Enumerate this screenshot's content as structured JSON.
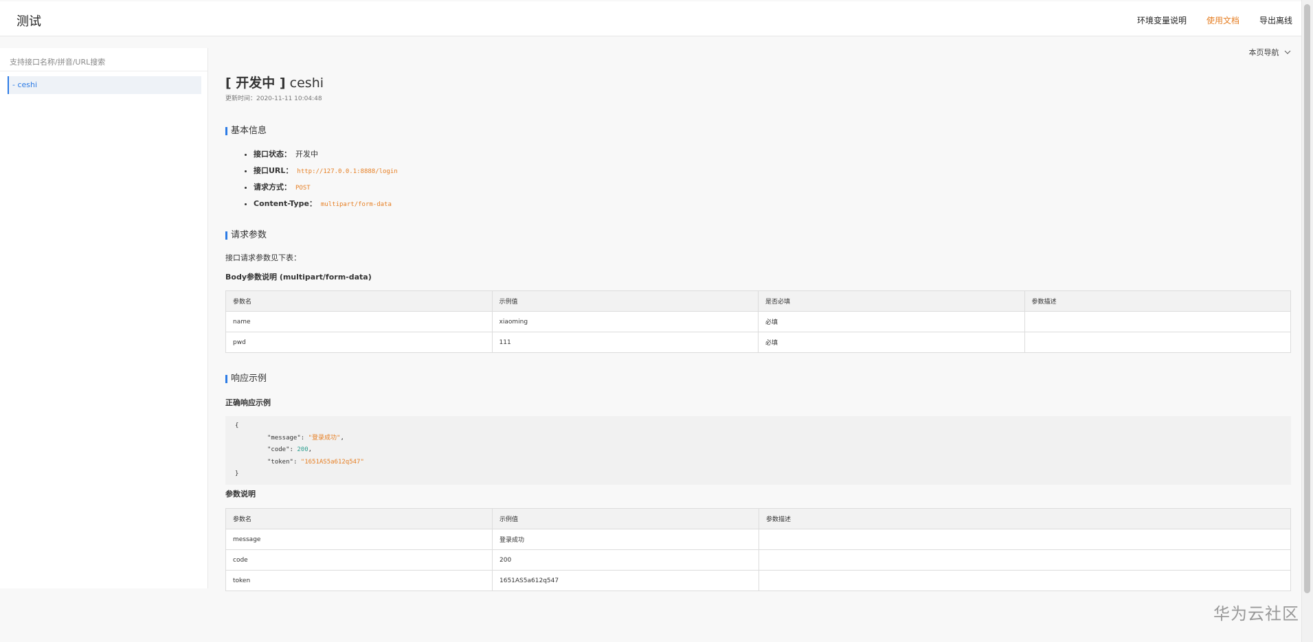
{
  "header": {
    "app_title": "测试",
    "nav": [
      "环境变量说明",
      "使用文档",
      "导出离线"
    ]
  },
  "sidebar": {
    "search_placeholder": "支持接口名称/拼音/URL搜索",
    "item": "- ceshi"
  },
  "page_nav": "本页导航",
  "api": {
    "status_label": "[ 开发中 ]",
    "name": "ceshi",
    "update_time": "更新时间：2020-11-11 10:04:48"
  },
  "basic": {
    "title": "基本信息",
    "items": [
      {
        "label": "接口状态：",
        "value": "开发中"
      },
      {
        "label": "接口URL：",
        "value": "http://127.0.0.1:8888/login"
      },
      {
        "label": "请求方式：",
        "value": "POST"
      },
      {
        "label": "Content-Type：",
        "value": "multipart/form-data"
      }
    ]
  },
  "request": {
    "title": "请求参数",
    "note": "接口请求参数见下表：",
    "body_title": "Body参数说明 (multipart/form-data)",
    "headers": [
      "参数名",
      "示例值",
      "是否必填",
      "参数描述"
    ],
    "rows": [
      [
        "name",
        "xiaoming",
        "必填",
        ""
      ],
      [
        "pwd",
        "111",
        "必填",
        ""
      ]
    ]
  },
  "response": {
    "title": "响应示例",
    "ok_title": "正确响应示例",
    "code": {
      "open": "{",
      "lines": [
        {
          "key": "\"message\"",
          "value": "\"登录成功\"",
          "sep": ","
        },
        {
          "key": "\"code\"",
          "value": "200",
          "sep": ","
        },
        {
          "key": "\"token\"",
          "value": "\"1651AS5a612q547\"",
          "sep": ""
        }
      ],
      "close": "}"
    },
    "params_title": "参数说明",
    "headers": [
      "参数名",
      "示例值",
      "参数描述"
    ],
    "rows": [
      [
        "message",
        "登录成功",
        ""
      ],
      [
        "code",
        "200",
        ""
      ],
      [
        "token",
        "1651AS5a612q547",
        ""
      ]
    ]
  },
  "watermark": "华为云社区",
  "colors": {
    "accent": "#2c7be5",
    "code_orange": "#e67e22",
    "active_nav": "#e67e22"
  }
}
